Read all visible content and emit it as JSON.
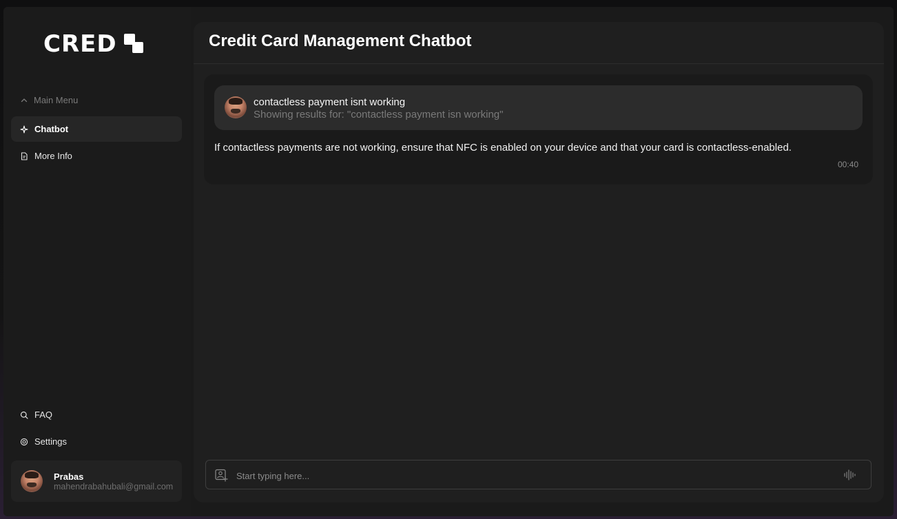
{
  "brand": {
    "logo_text": "CRED"
  },
  "sidebar": {
    "menu_header": "Main Menu",
    "items": [
      {
        "label": "Chatbot",
        "icon": "sparkle-icon",
        "active": true
      },
      {
        "label": "More Info",
        "icon": "document-icon",
        "active": false
      }
    ],
    "bottom_items": [
      {
        "label": "FAQ",
        "icon": "search-icon"
      },
      {
        "label": "Settings",
        "icon": "gear-icon"
      }
    ],
    "user": {
      "name": "Prabas",
      "email": "mahendrabahubali@gmail.com"
    }
  },
  "main": {
    "title": "Credit Card Management Chatbot",
    "conversation": {
      "query": "contactless payment isnt working",
      "query_note": "Showing results for: \"contactless payment isn working\"",
      "answer": "If contactless payments are not working, ensure that NFC is enabled on your device and that your card is contactless-enabled.",
      "time": "00:40"
    },
    "input": {
      "placeholder": "Start typing here...",
      "value": ""
    }
  },
  "colors": {
    "background": "#1a1a1a",
    "panel": "#1f1f1f",
    "active_item": "#262626",
    "query_bubble": "#2c2c2c",
    "muted_text": "#7a7a7a"
  }
}
